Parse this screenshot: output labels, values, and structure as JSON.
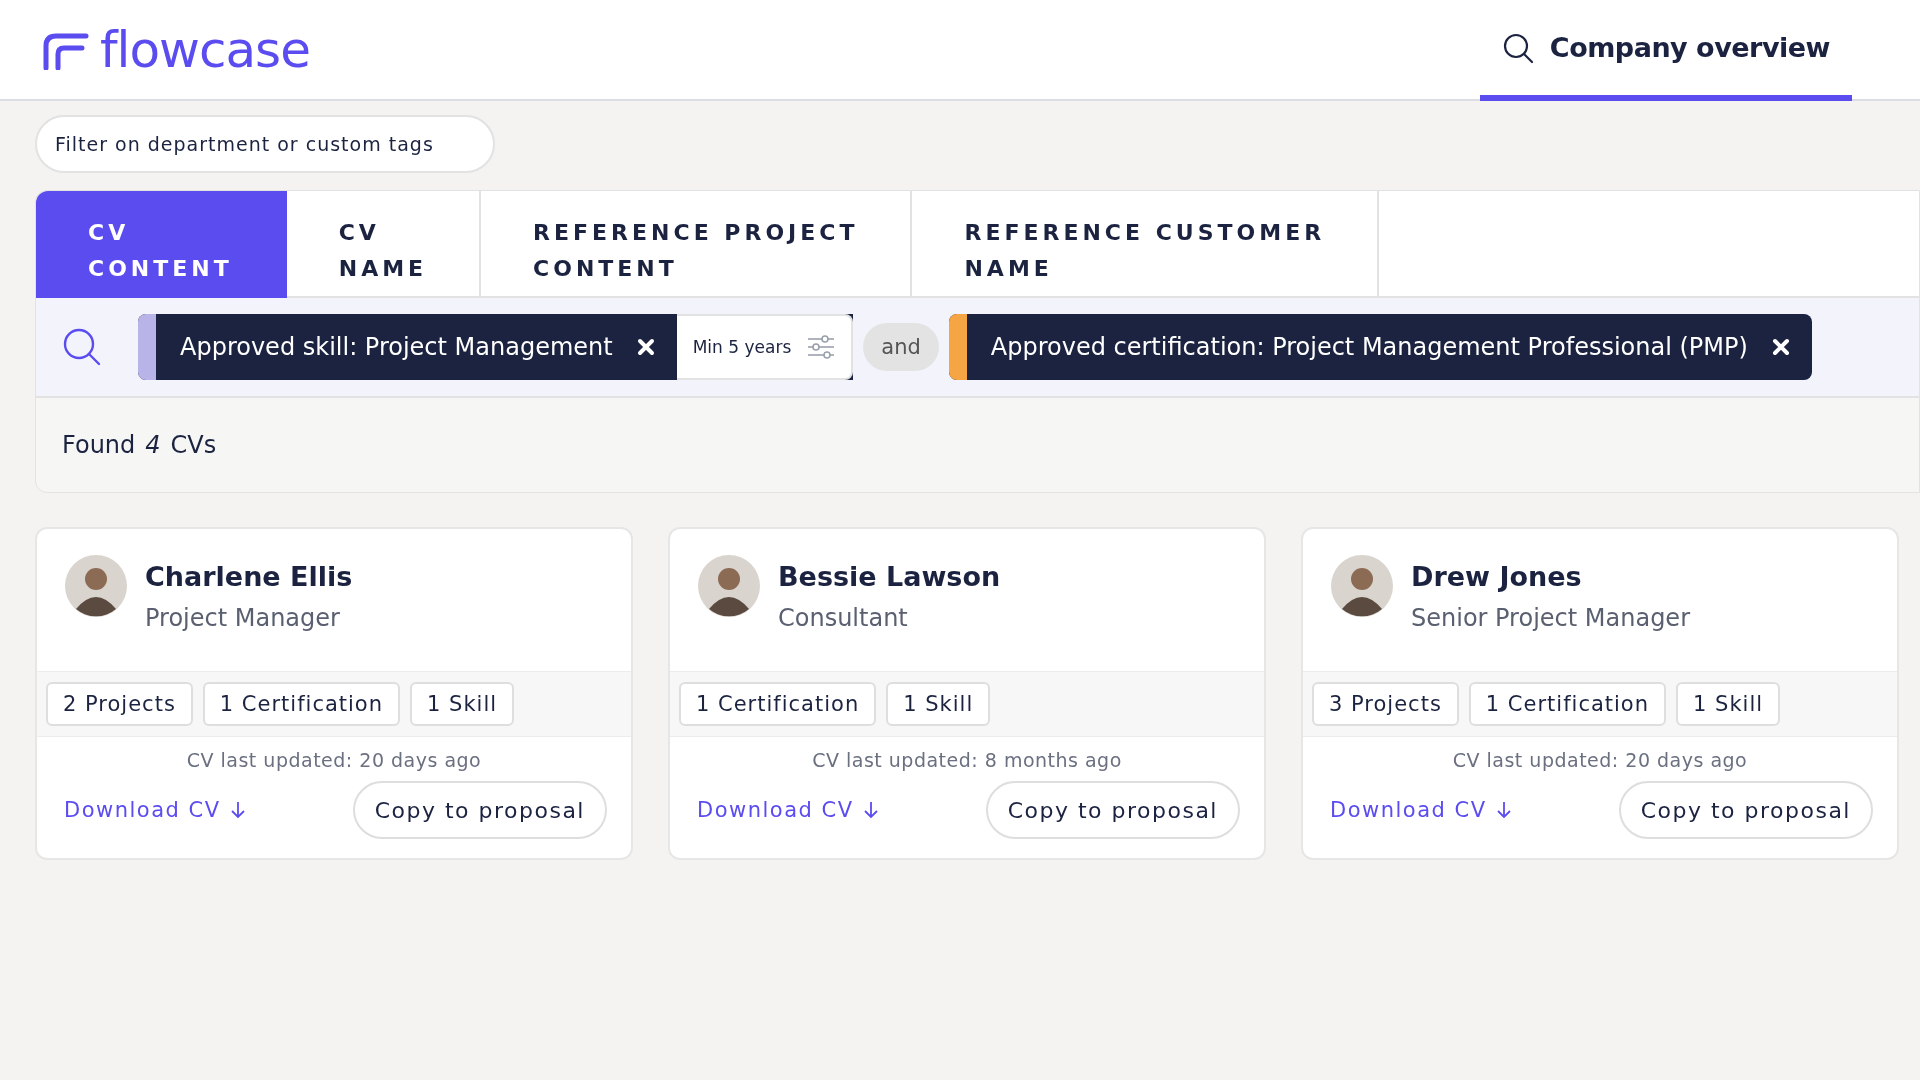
{
  "header": {
    "logo": "flowcase",
    "nav_tab": {
      "label": "Company overview",
      "selected": true
    }
  },
  "filter": {
    "placeholder": "Filter on department or custom tags"
  },
  "tabs": [
    {
      "line1": "CV",
      "line2": "CONTENT",
      "selected": true
    },
    {
      "line1": "CV",
      "line2": "NAME",
      "selected": false
    },
    {
      "line1": "REFERENCE PROJECT",
      "line2": "CONTENT",
      "selected": false
    },
    {
      "line1": "REFERENCE CUSTOMER",
      "line2": "NAME",
      "selected": false
    }
  ],
  "query": {
    "chips": [
      {
        "label": "Approved skill: Project Management",
        "color": "#b8b4e8",
        "option": "Min 5 years"
      },
      {
        "label": "Approved certification: Project Management Professional (PMP)",
        "color": "#f5a543"
      }
    ],
    "connector": "and"
  },
  "results": {
    "text": "Found *4* CVs"
  },
  "cards": [
    {
      "name": "Charlene Ellis",
      "title": "Project Manager",
      "tags": [
        "2 Projects",
        "1 Certification",
        "1 Skill"
      ],
      "updated": "CV last updated: 20 days ago",
      "download": "Download CV",
      "action": "Copy to proposal"
    },
    {
      "name": "Bessie Lawson",
      "title": "Consultant",
      "tags": [
        "1 Certification",
        "1 Skill"
      ],
      "updated": "CV last updated: 8 months ago",
      "download": "Download CV",
      "action": "Copy to proposal"
    },
    {
      "name": "Drew Jones",
      "title": "Senior Project Manager",
      "tags": [
        "3 Projects",
        "1 Certification",
        "1 Skill"
      ],
      "updated": "CV last updated: 20 days ago",
      "download": "Download CV",
      "action": "Copy to proposal"
    }
  ]
}
